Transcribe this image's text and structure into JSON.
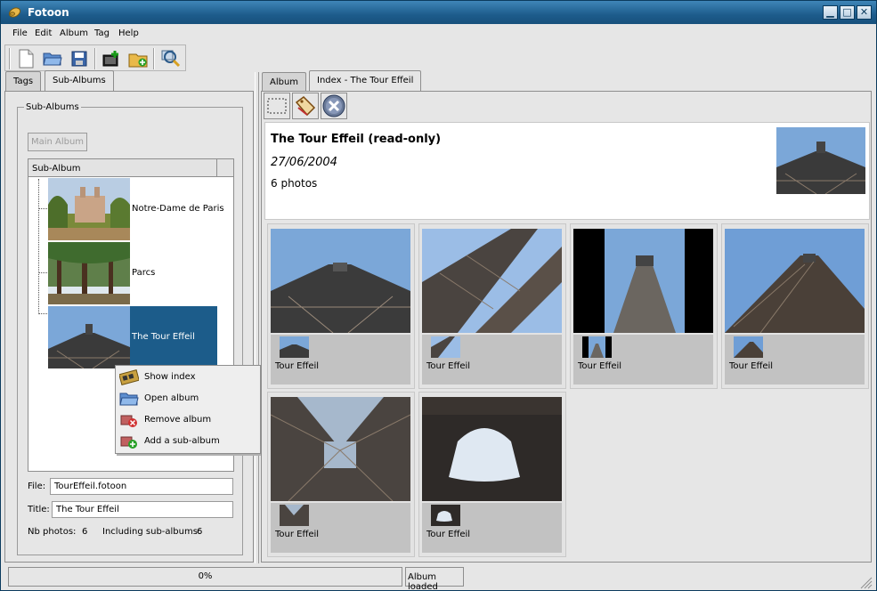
{
  "window": {
    "title": "Fotoon",
    "app_icon": "film-roll-icon",
    "controls": [
      "minimize-icon",
      "maximize-icon",
      "close-icon"
    ]
  },
  "menubar": {
    "items": [
      "File",
      "Edit",
      "Album",
      "Tag",
      "Help"
    ]
  },
  "toolbar": {
    "icons": [
      "new-document-icon",
      "open-folder-icon",
      "save-icon",
      "add-to-album-icon",
      "new-album-icon",
      "search-icon"
    ]
  },
  "left_tabs": [
    {
      "label": "Tags",
      "active": false
    },
    {
      "label": "Sub-Albums",
      "active": true
    }
  ],
  "subalbums": {
    "group_label": "Sub-Albums",
    "main_album_button": "Main Album",
    "column_header": "Sub-Album",
    "items": [
      {
        "label": "Notre-Dame de Paris",
        "selected": false
      },
      {
        "label": "Parcs",
        "selected": false
      },
      {
        "label": "The Tour Effeil",
        "selected": true
      }
    ],
    "file_label": "File:",
    "file_value": "TourEffeil.fotoon",
    "title_label": "Title:",
    "title_value": "The Tour Effeil",
    "nb_photos_label": "Nb photos:",
    "nb_photos": "6",
    "including_label": "Including sub-albums:",
    "including_value": "6"
  },
  "context_menu": {
    "items": [
      {
        "label": "Show index",
        "icon": "film-strip-icon"
      },
      {
        "label": "Open album",
        "icon": "open-folder-icon"
      },
      {
        "label": "Remove album",
        "icon": "remove-album-icon"
      },
      {
        "label": "Add a sub-album",
        "icon": "add-album-icon"
      }
    ]
  },
  "right_tabs": [
    {
      "label": "Album",
      "active": false
    },
    {
      "label": "Index - The Tour Effeil",
      "active": true
    }
  ],
  "index_toolbar": {
    "icons": [
      "select-frame-icon",
      "tag-icon",
      "close-circle-icon"
    ]
  },
  "album_header": {
    "title": "The Tour Effeil (read-only)",
    "date": "27/06/2004",
    "count": "6 photos"
  },
  "photos": [
    {
      "caption": "Tour Effeil"
    },
    {
      "caption": "Tour Effeil"
    },
    {
      "caption": "Tour Effeil"
    },
    {
      "caption": "Tour Effeil"
    },
    {
      "caption": "Tour Effeil"
    },
    {
      "caption": "Tour Effeil"
    }
  ],
  "statusbar": {
    "progress": "0%",
    "progress_value": 0,
    "message": "Album loaded"
  },
  "colors": {
    "titlebar": "#1d5c8a",
    "selection": "#1c5c8a",
    "sky": "#7ba7d8"
  }
}
